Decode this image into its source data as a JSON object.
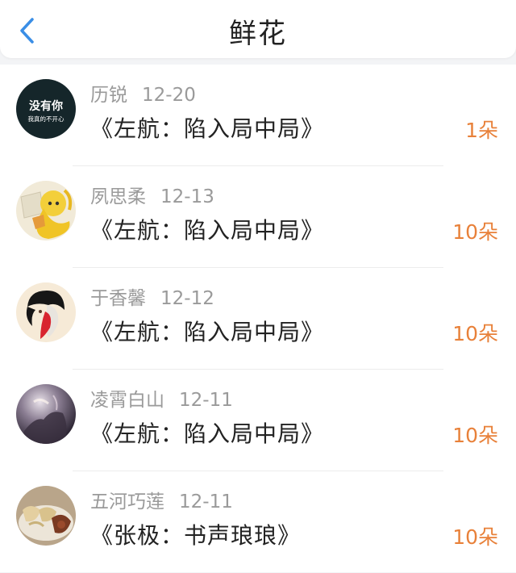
{
  "header": {
    "title": "鲜花",
    "back_icon": "chevron-left-icon",
    "accent_color": "#3a8ee6"
  },
  "list": {
    "items": [
      {
        "name": "历锐",
        "date": "12-20",
        "book": "《左航：陷入局中局》",
        "count": "1朵",
        "avatar_text_main": "没有你",
        "avatar_text_sub": "我真的不开心"
      },
      {
        "name": "夙思柔",
        "date": "12-13",
        "book": "《左航：陷入局中局》",
        "count": "10朵"
      },
      {
        "name": "于香馨",
        "date": "12-12",
        "book": "《左航：陷入局中局》",
        "count": "10朵"
      },
      {
        "name": "凌霄白山",
        "date": "12-11",
        "book": "《左航：陷入局中局》",
        "count": "10朵"
      },
      {
        "name": "五河巧莲",
        "date": "12-11",
        "book": "《张极：书声琅琅》",
        "count": "10朵"
      }
    ]
  },
  "colors": {
    "count": "#e8813a",
    "name": "#9a9a9a",
    "book": "#222222"
  }
}
